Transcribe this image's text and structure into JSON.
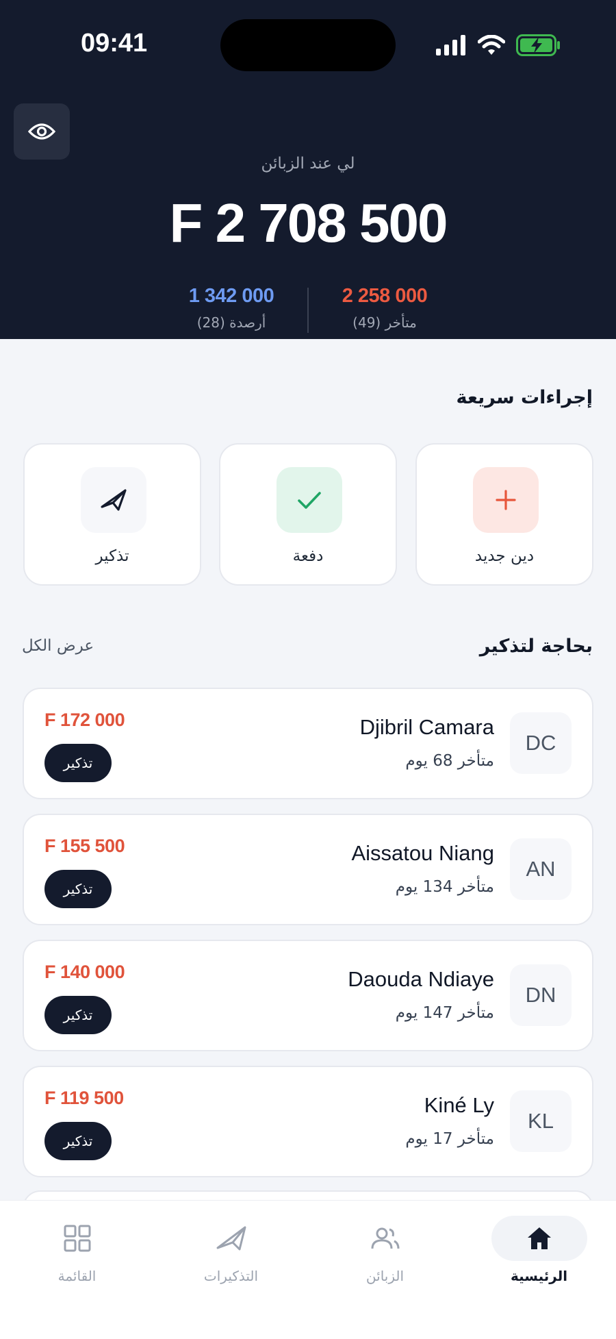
{
  "status_bar": {
    "time": "09:41"
  },
  "hero": {
    "label": "لي عند الزبائن",
    "total": "F 2 708 500",
    "credit": {
      "value": "1 342 000",
      "label": "أرصدة (28)"
    },
    "overdue": {
      "value": "2 258 000",
      "label": "متأخر (49)"
    }
  },
  "quick_actions": {
    "title": "إجراءات سريعة",
    "items": [
      {
        "label": "دين جديد",
        "icon": "plus-icon",
        "color": "#E7563B",
        "bg": "#FDE7E3"
      },
      {
        "label": "دفعة",
        "icon": "check-icon",
        "color": "#1FA565",
        "bg": "#E2F5EB"
      },
      {
        "label": "تذكير",
        "icon": "paper-plane-icon",
        "color": "#141B2D",
        "bg": "#F6F7FA"
      }
    ]
  },
  "reminders": {
    "title": "بحاجة لتذكير",
    "view_all": "عرض الكل",
    "items": [
      {
        "initials": "DC",
        "name": "Djibril Camara",
        "late": "متأخر 68 يوم",
        "amount": "F 172 000",
        "action": "تذكير"
      },
      {
        "initials": "AN",
        "name": "Aissatou Niang",
        "late": "متأخر 134 يوم",
        "amount": "F 155 500",
        "action": "تذكير"
      },
      {
        "initials": "DN",
        "name": "Daouda Ndiaye",
        "late": "متأخر 147 يوم",
        "amount": "F 140 000",
        "action": "تذكير"
      },
      {
        "initials": "KL",
        "name": "Kiné Ly",
        "late": "متأخر 17 يوم",
        "amount": "F 119 500",
        "action": "تذكير"
      }
    ]
  },
  "tabbar": {
    "items": [
      {
        "label": "الرئيسية",
        "icon": "home-icon",
        "active": true
      },
      {
        "label": "الزبائن",
        "icon": "users-icon",
        "active": false
      },
      {
        "label": "التذكيرات",
        "icon": "paper-plane-icon",
        "active": false
      },
      {
        "label": "القائمة",
        "icon": "grid-icon",
        "active": false
      }
    ]
  },
  "colors": {
    "hero_bg": "#141B2D",
    "overdue": "#EC5A41",
    "credit": "#6E9BF2",
    "amount": "#E0533B"
  }
}
